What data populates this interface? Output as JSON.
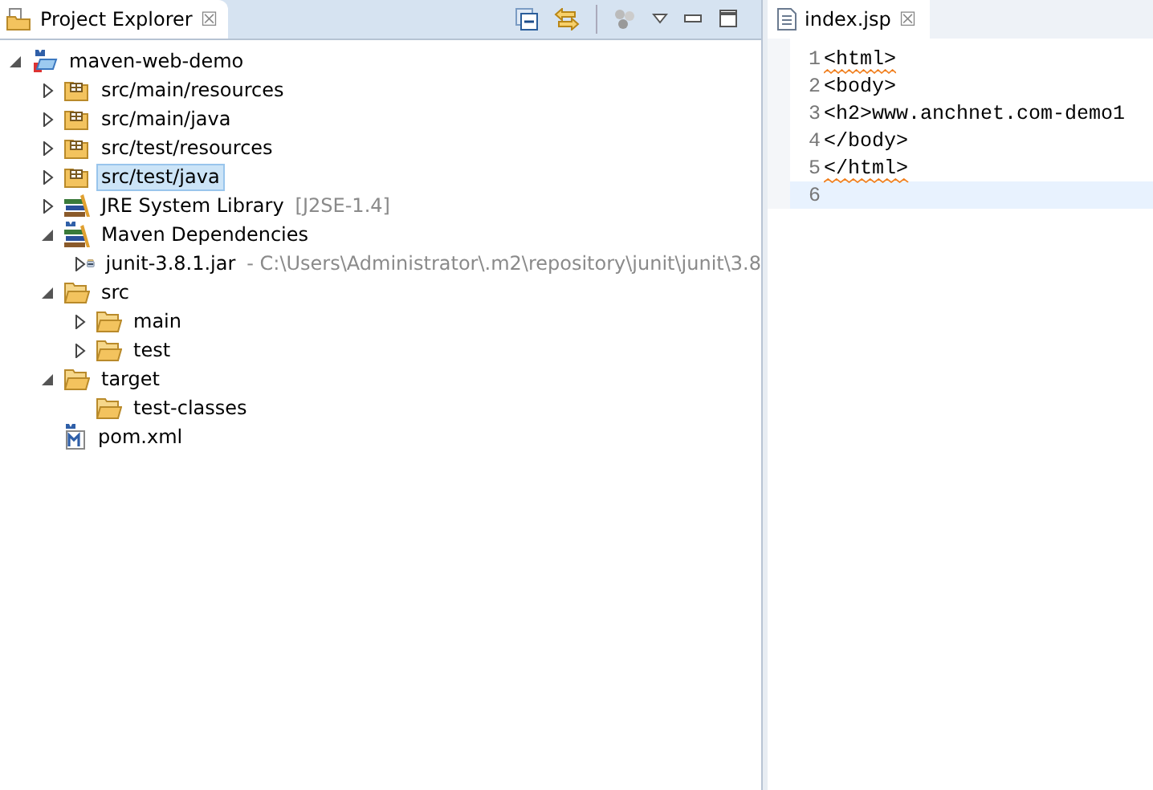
{
  "explorer": {
    "title": "Project Explorer",
    "close": "☒",
    "tree": [
      {
        "label": "maven-web-demo",
        "kind": "project",
        "expanded": true,
        "selected": false,
        "children": [
          {
            "label": "src/main/resources",
            "kind": "package",
            "expanded": false,
            "selected": false
          },
          {
            "label": "src/main/java",
            "kind": "package",
            "expanded": false,
            "selected": false
          },
          {
            "label": "src/test/resources",
            "kind": "package",
            "expanded": false,
            "selected": false
          },
          {
            "label": "src/test/java",
            "kind": "package",
            "expanded": false,
            "selected": true
          },
          {
            "label": "JRE System Library",
            "decoration": "[J2SE-1.4]",
            "kind": "library",
            "expanded": false,
            "selected": false
          },
          {
            "label": "Maven Dependencies",
            "kind": "maven-library",
            "expanded": true,
            "selected": false,
            "children": [
              {
                "label": "junit-3.8.1.jar",
                "decoration": "- C:\\Users\\Administrator\\.m2\\repository\\junit\\junit\\3.8",
                "kind": "jar",
                "expanded": false,
                "selected": false
              }
            ]
          },
          {
            "label": "src",
            "kind": "folder",
            "expanded": true,
            "selected": false,
            "children": [
              {
                "label": "main",
                "kind": "folder",
                "expanded": false,
                "selected": false
              },
              {
                "label": "test",
                "kind": "folder",
                "expanded": false,
                "selected": false
              }
            ]
          },
          {
            "label": "target",
            "kind": "folder",
            "expanded": true,
            "selected": false,
            "children": [
              {
                "label": "test-classes",
                "kind": "folder",
                "selected": false
              }
            ]
          },
          {
            "label": "pom.xml",
            "kind": "pom",
            "selected": false
          }
        ]
      }
    ]
  },
  "editor": {
    "tab": "index.jsp",
    "close": "☒",
    "lines": [
      {
        "number": "1",
        "text": "<html>",
        "warning": true,
        "current": false
      },
      {
        "number": "2",
        "text": "<body>",
        "warning": false,
        "current": false
      },
      {
        "number": "3",
        "text": "<h2>www.anchnet.com-demo1",
        "warning": false,
        "current": false
      },
      {
        "number": "4",
        "text": "</body>",
        "warning": false,
        "current": false
      },
      {
        "number": "5",
        "text": "</html>",
        "warning": true,
        "current": false
      },
      {
        "number": "6",
        "current": true
      }
    ]
  }
}
